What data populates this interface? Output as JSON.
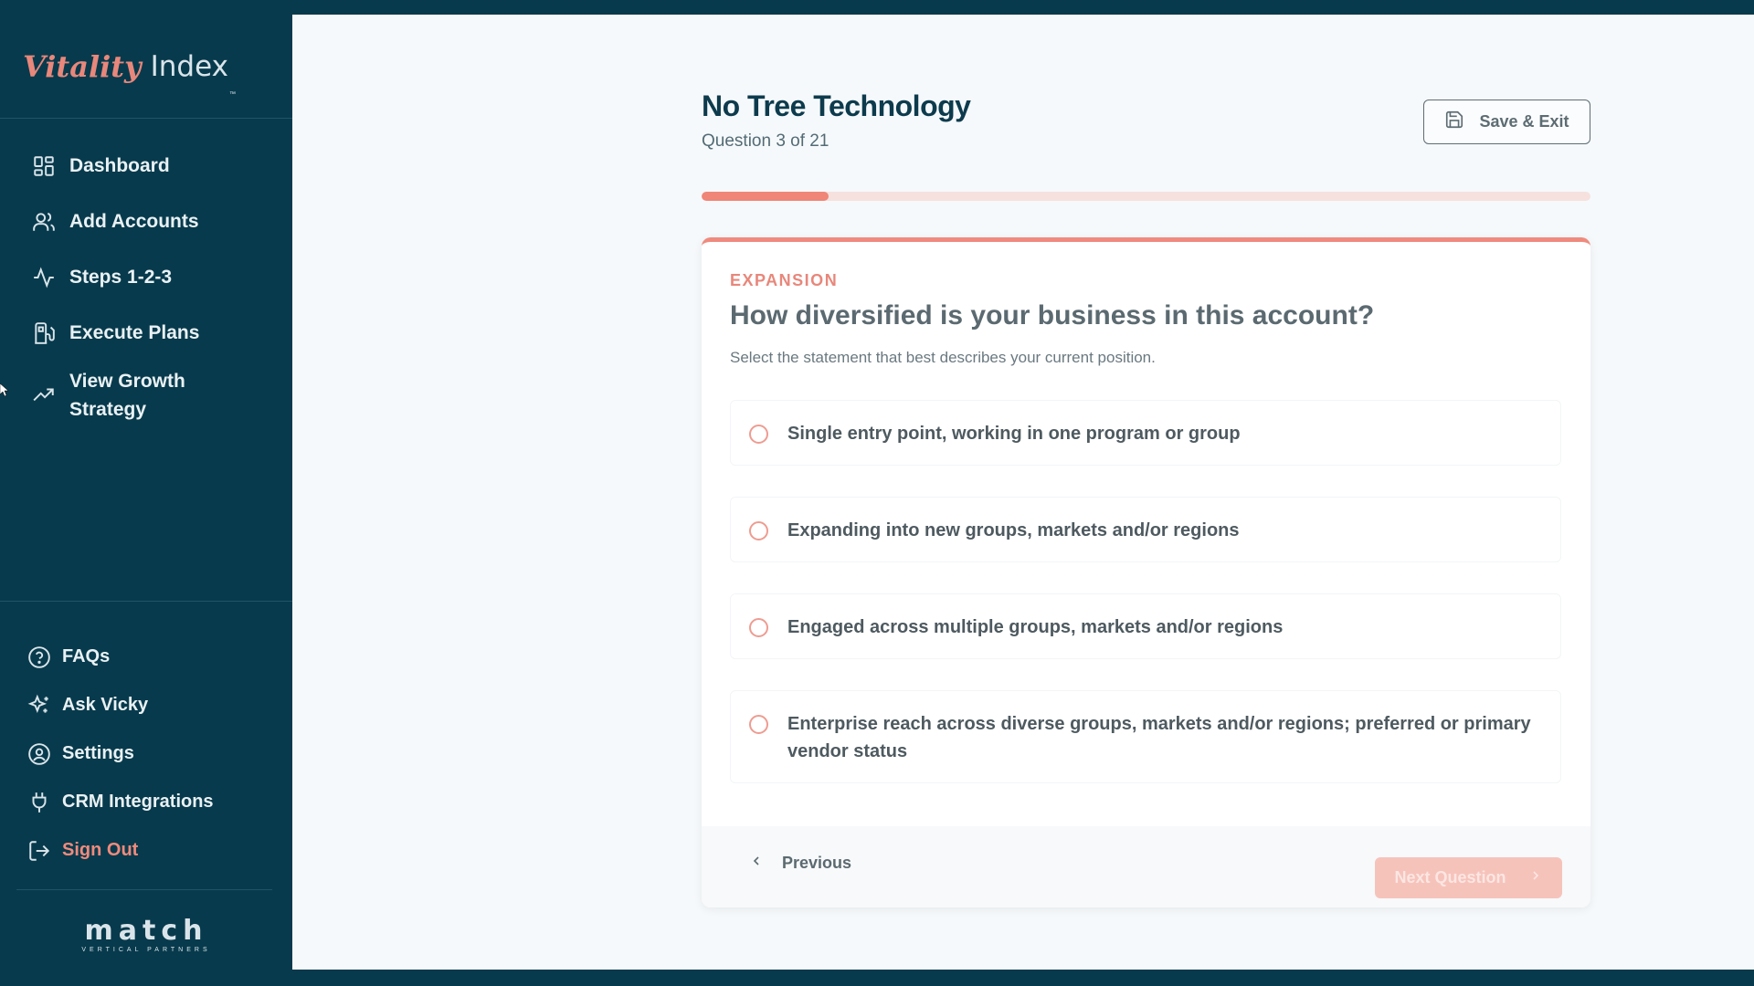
{
  "brand": {
    "logo_part1": "Vitality",
    "logo_part2": "Index",
    "logo_tm": "™",
    "footer_logo": "match",
    "footer_logo_sub": "VERTICAL PARTNERS"
  },
  "sidebar": {
    "items": [
      {
        "label": "Dashboard",
        "icon": "dashboard-icon"
      },
      {
        "label": "Add Accounts",
        "icon": "users-icon"
      },
      {
        "label": "Steps 1-2-3",
        "icon": "activity-icon"
      },
      {
        "label": "Execute Plans",
        "icon": "fuel-icon"
      },
      {
        "label": "View Growth Strategy",
        "icon": "trending-up-icon"
      }
    ],
    "bottom_items": [
      {
        "label": "FAQs",
        "icon": "help-circle-icon"
      },
      {
        "label": "Ask Vicky",
        "icon": "sparkles-icon"
      },
      {
        "label": "Settings",
        "icon": "user-circle-icon"
      },
      {
        "label": "CRM Integrations",
        "icon": "plug-icon"
      },
      {
        "label": "Sign Out",
        "icon": "log-out-icon"
      }
    ]
  },
  "header": {
    "title": "No Tree Technology",
    "subtitle": "Question 3 of 21",
    "save_label": "Save & Exit"
  },
  "progress": {
    "current": 3,
    "total": 21
  },
  "question": {
    "category": "EXPANSION",
    "text": "How diversified is your business in this account?",
    "instruction": "Select the statement that best describes your current position.",
    "options": [
      "Single entry point, working in one program or group",
      "Expanding into new groups, markets and/or regions",
      "Engaged across multiple groups, markets and/or regions",
      "Enterprise reach across diverse groups, markets and/or regions; preferred or primary vendor status"
    ]
  },
  "footer": {
    "prev_label": "Previous",
    "next_label": "Next Question"
  },
  "colors": {
    "sidebar_bg": "#073a4c",
    "accent": "#ee8678",
    "main_bg": "#f6f9fb"
  }
}
